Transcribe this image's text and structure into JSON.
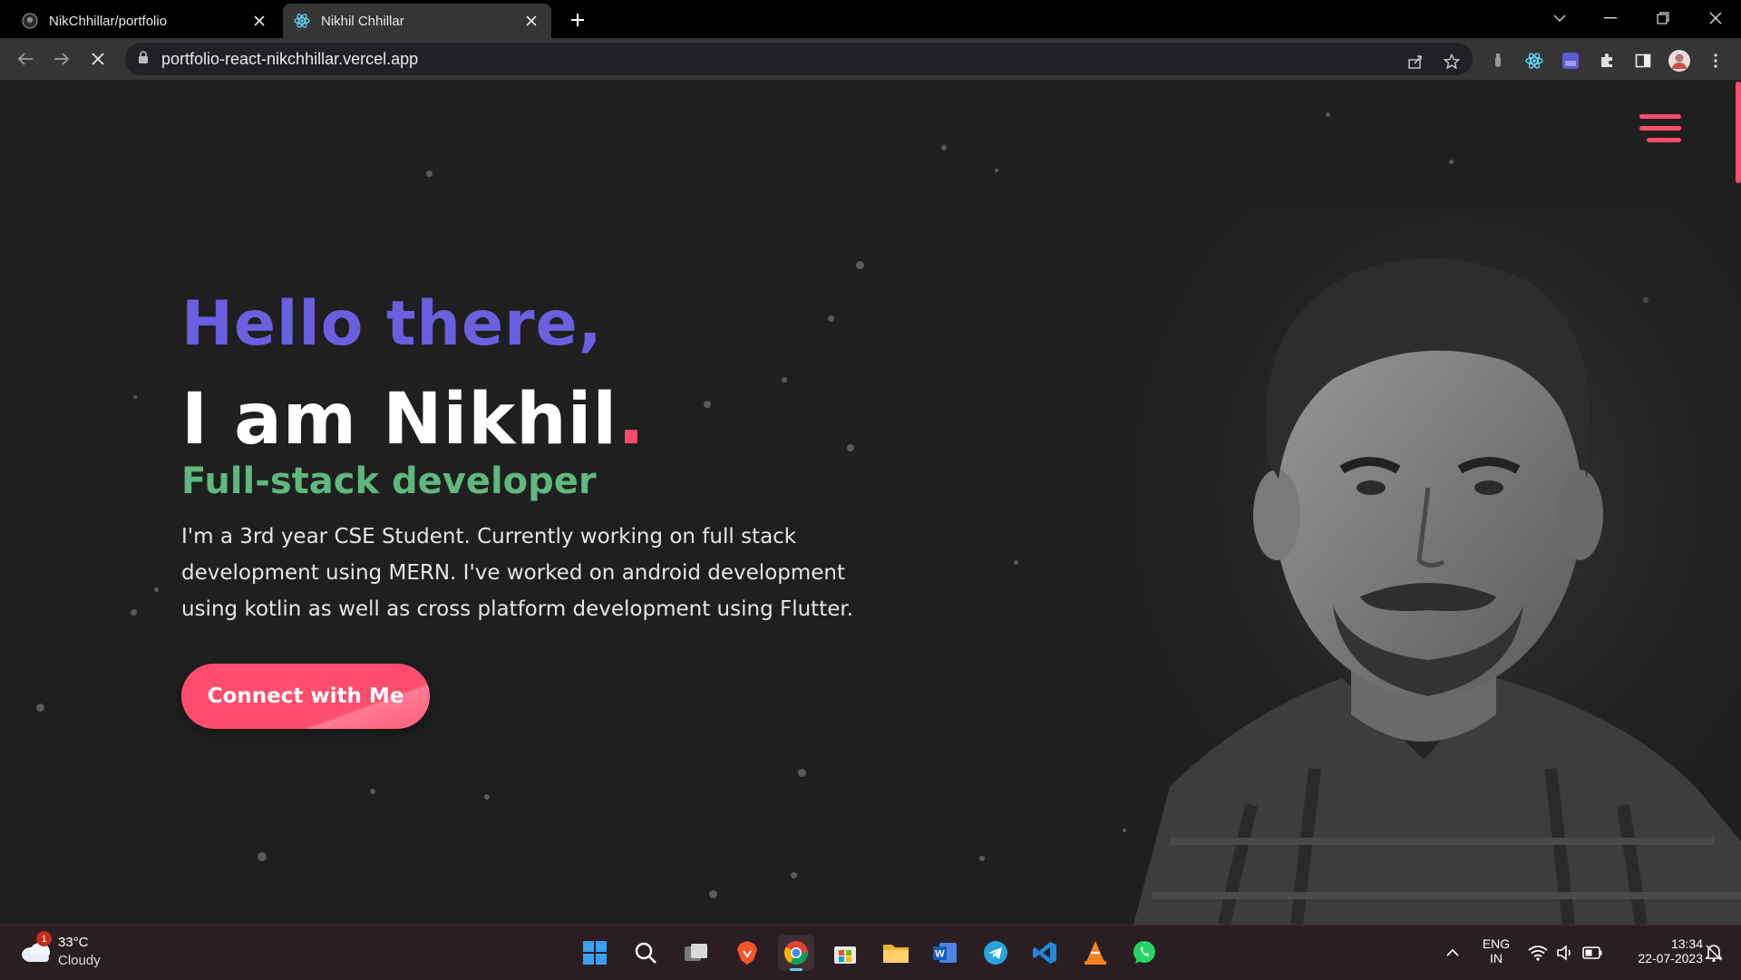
{
  "browser": {
    "tabs": [
      {
        "title": "NikChhillar/portfolio",
        "active": false
      },
      {
        "title": "Nikhil Chhillar",
        "active": true
      }
    ],
    "url": "portfolio-react-nikchhillar.vercel.app"
  },
  "hero": {
    "greeting": "Hello there,",
    "name_prefix": "I am Nikhil",
    "name_dot": ".",
    "role": "Full-stack developer",
    "bio": "I'm a 3rd year CSE Student. Currently working on full stack development using MERN. I've worked on android development using kotlin as well as cross platform development using Flutter.",
    "cta_label": "Connect with Me"
  },
  "taskbar": {
    "weather": {
      "temp": "33°C",
      "condition": "Cloudy",
      "badge": "1"
    },
    "lang": "ENG",
    "region": "IN",
    "time": "13:34",
    "date": "22-07-2023"
  },
  "colors": {
    "accent": "#ff4d6d",
    "greeting": "#6b5fe0",
    "role": "#5fb87c",
    "background": "#1f1f1f"
  }
}
